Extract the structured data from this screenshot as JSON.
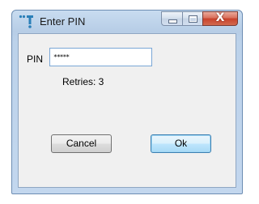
{
  "window": {
    "title": "Enter PIN",
    "app_icon": "app-logo-icon",
    "caption_buttons": [
      "minimize-icon",
      "maximize-icon",
      "close-icon"
    ],
    "close_glyph": "X"
  },
  "form": {
    "pin_label": "PIN",
    "pin_value": "*****",
    "retries_text": "Retries: 3"
  },
  "buttons": {
    "cancel_label": "Cancel",
    "ok_label": "Ok"
  },
  "colors": {
    "frame": "#bcd2ea",
    "client": "#f0f0f0",
    "close_button": "#c8412b",
    "focus_border": "#7aa7d6",
    "ok_button": "#bee6fd"
  }
}
